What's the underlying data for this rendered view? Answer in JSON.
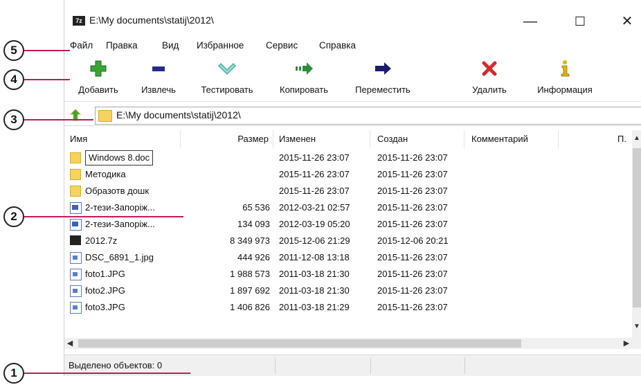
{
  "window": {
    "title": "E:\\My documents\\statij\\2012\\",
    "app_icon": "7z",
    "minimize": "—",
    "maximize": "☐",
    "close": "✕"
  },
  "menu": [
    {
      "label": "Файл"
    },
    {
      "label": "Правка"
    },
    {
      "label": "Вид"
    },
    {
      "label": "Избранное"
    },
    {
      "label": "Сервис"
    },
    {
      "label": "Справка"
    }
  ],
  "toolbar": {
    "add": "Добавить",
    "extract": "Извлечь",
    "test": "Тестировать",
    "copy": "Копировать",
    "move": "Переместить",
    "delete": "Удалить",
    "info": "Информация"
  },
  "address": {
    "path": "E:\\My documents\\statij\\2012\\"
  },
  "columns": {
    "name": "Имя",
    "size": "Размер",
    "modified": "Изменен",
    "created": "Создан",
    "comment": "Комментарий",
    "more": "П."
  },
  "files": [
    {
      "icon": "folder-icon",
      "name": "Windows 8.doc",
      "size": "",
      "modified": "2015-11-26 23:07",
      "created": "2015-11-26 23:07"
    },
    {
      "icon": "folder-icon",
      "name": "Методика",
      "size": "",
      "modified": "2015-11-26 23:07",
      "created": "2015-11-26 23:07"
    },
    {
      "icon": "folder-icon",
      "name": "Образотв дошк",
      "size": "",
      "modified": "2015-11-26 23:07",
      "created": "2015-11-26 23:07"
    },
    {
      "icon": "word-doc-icon",
      "name": "2-тези-Запоріж...",
      "size": "65 536",
      "modified": "2012-03-21 02:57",
      "created": "2015-11-26 23:07"
    },
    {
      "icon": "word-doc-icon",
      "name": "2-тези-Запоріж...",
      "size": "134 093",
      "modified": "2012-03-19 05:20",
      "created": "2015-11-26 23:07"
    },
    {
      "icon": "archive-7z-icon",
      "name": "2012.7z",
      "size": "8 349 973",
      "modified": "2015-12-06 21:29",
      "created": "2015-12-06 20:21"
    },
    {
      "icon": "image-file-icon",
      "name": "DSC_6891_1.jpg",
      "size": "444 926",
      "modified": "2011-12-08 13:18",
      "created": "2015-11-26 23:07"
    },
    {
      "icon": "image-file-icon",
      "name": "foto1.JPG",
      "size": "1 988 573",
      "modified": "2011-03-18 21:30",
      "created": "2015-11-26 23:07"
    },
    {
      "icon": "image-file-icon",
      "name": "foto2.JPG",
      "size": "1 897 692",
      "modified": "2011-03-18 21:30",
      "created": "2015-11-26 23:07"
    },
    {
      "icon": "image-file-icon",
      "name": "foto3.JPG",
      "size": "1 406 826",
      "modified": "2011-03-18 21:29",
      "created": "2015-11-26 23:07"
    }
  ],
  "status": {
    "text": "Выделено объектов: 0"
  },
  "callouts": [
    "1",
    "2",
    "3",
    "4",
    "5"
  ],
  "colors": {
    "callout_line": "#c2185b",
    "add_green": "#3aa335",
    "extract_blue": "#2a2a8c",
    "test_teal": "#47b0a5",
    "copy_green": "#2e8b3a",
    "move_navy": "#1c1c6e",
    "delete_red": "#d42a2a",
    "info_yellow": "#e2b400"
  }
}
